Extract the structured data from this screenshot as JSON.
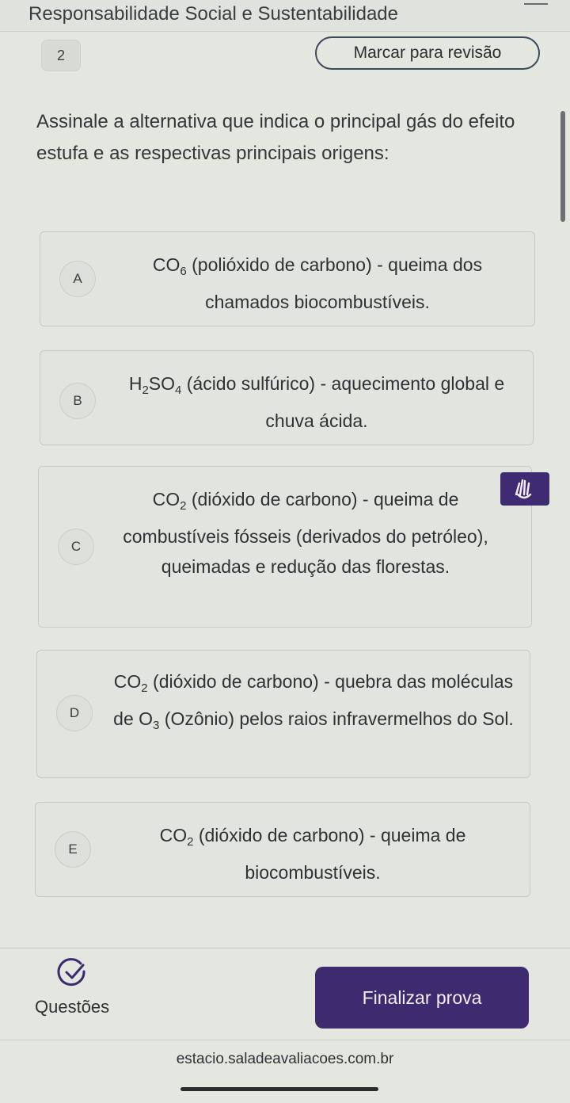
{
  "header": {
    "title": "Responsabilidade Social e Sustentabilidade"
  },
  "question": {
    "number": "2",
    "mark_review_label": "Marcar para revisão",
    "text": "Assinale a alternativa que indica o principal gás do efeito estufa e as respectivas principais origens:"
  },
  "options": [
    {
      "letter": "A",
      "formula": "CO",
      "formula_sub": "6",
      "text": " (polióxido de carbono) - queima dos chamados biocombustíveis."
    },
    {
      "letter": "B",
      "formula": "H",
      "formula_sub": "2",
      "formula2": "SO",
      "formula2_sub": "4",
      "text": " (ácido sulfúrico) - aquecimento global e chuva ácida."
    },
    {
      "letter": "C",
      "formula": "CO",
      "formula_sub": "2",
      "text": " (dióxido de carbono) - queima de combustíveis fósseis (derivados do petróleo), queimadas e redução das florestas."
    },
    {
      "letter": "D",
      "formula": "CO",
      "formula_sub": "2",
      "text": " (dióxido de carbono) - quebra das moléculas de ",
      "formula2": "O",
      "formula2_sub": "3",
      "text2": " (Ozônio) pelos raios infravermelhos do Sol."
    },
    {
      "letter": "E",
      "formula": "CO",
      "formula_sub": "2",
      "text": " (dióxido de carbono) - queima de biocombustíveis."
    }
  ],
  "footer": {
    "questions_label": "Questões",
    "finish_label": "Finalizar prova",
    "domain": "estacio.saladeavaliacoes.com.br"
  },
  "icons": {
    "check": "check-circle-icon",
    "accessibility": "sign-language-icon"
  },
  "colors": {
    "primary": "#3e2a6e",
    "background": "#e4e6e0"
  }
}
